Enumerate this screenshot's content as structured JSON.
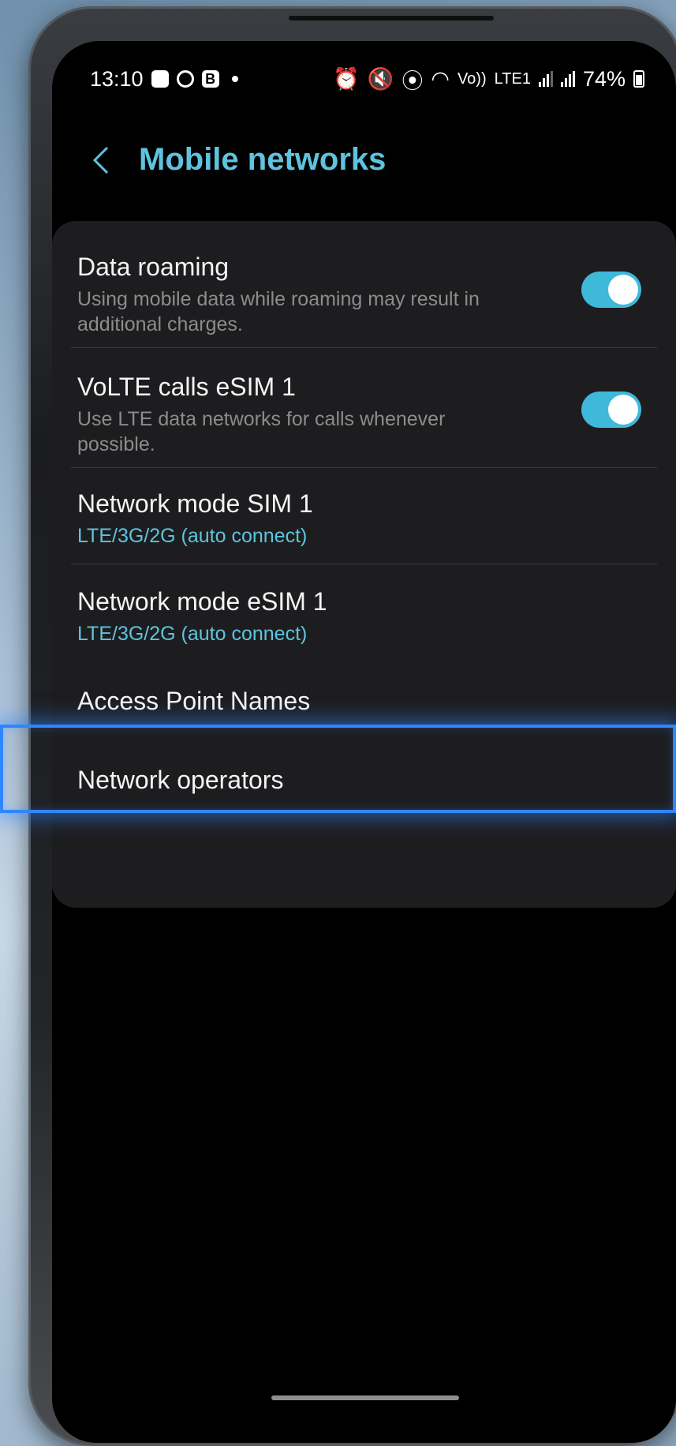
{
  "status_bar": {
    "time": "13:10",
    "battery_percent": "74%",
    "volte_glyph": "Vo))",
    "lte_glyph": "LTE1",
    "left_icons": [
      "gallery-icon",
      "whatsapp-icon",
      "b-app-icon",
      "notification-dot-icon"
    ],
    "right_icons": [
      "alarm-icon",
      "mute-icon",
      "location-icon",
      "wifi-icon",
      "volte-icon",
      "signal-icon",
      "signal-icon",
      "battery-icon"
    ]
  },
  "header": {
    "title": "Mobile networks"
  },
  "settings": {
    "items": [
      {
        "title": "Data roaming",
        "subtitle": "Using mobile data while roaming may result in additional charges.",
        "toggle": true
      },
      {
        "title": "VoLTE calls eSIM 1",
        "subtitle": "Use LTE data networks for calls whenever possible.",
        "toggle": true
      },
      {
        "title": "Network mode SIM 1",
        "value": "LTE/3G/2G (auto connect)"
      },
      {
        "title": "Network mode eSIM 1",
        "value": "LTE/3G/2G (auto connect)"
      },
      {
        "title": "Access Point Names",
        "highlighted": true
      },
      {
        "title": "Network operators"
      }
    ]
  },
  "colors": {
    "accent": "#5fc3de",
    "toggle_on": "#3fb9d9",
    "highlight": "#2f86ff",
    "card_bg": "#1d1d1f"
  }
}
